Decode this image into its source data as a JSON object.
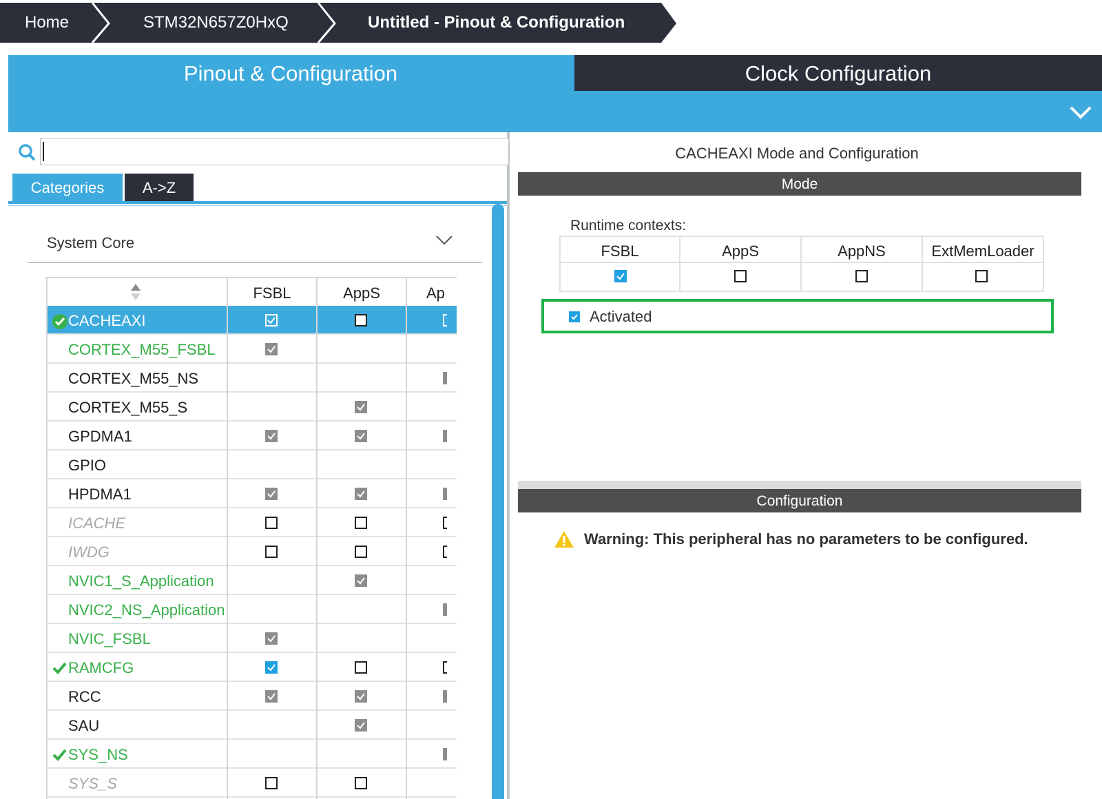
{
  "breadcrumb": {
    "items": [
      {
        "label": "Home"
      },
      {
        "label": "STM32N657Z0HxQ"
      },
      {
        "label": "Untitled - Pinout & Configuration"
      }
    ]
  },
  "main_tabs": {
    "pinout": "Pinout & Configuration",
    "clock": "Clock Configuration"
  },
  "left_panel": {
    "search": {
      "value": "",
      "placeholder": ""
    },
    "tabs": {
      "categories": "Categories",
      "atoz": "A->Z"
    },
    "category": "System Core",
    "table": {
      "columns": [
        "FSBL",
        "AppS",
        "Ap"
      ],
      "rows": [
        {
          "name": "CACHEAXI",
          "style": "normal",
          "status": "check-circle",
          "selected": true,
          "fsbl": "checked-white",
          "apps": "unchecked-white",
          "app3": "frag-white"
        },
        {
          "name": "CORTEX_M55_FSBL",
          "style": "green",
          "status": "",
          "selected": false,
          "fsbl": "checked-gray",
          "apps": "none",
          "app3": "none"
        },
        {
          "name": "CORTEX_M55_NS",
          "style": "normal",
          "status": "",
          "selected": false,
          "fsbl": "none",
          "apps": "none",
          "app3": "frag-gray"
        },
        {
          "name": "CORTEX_M55_S",
          "style": "normal",
          "status": "",
          "selected": false,
          "fsbl": "none",
          "apps": "checked-gray",
          "app3": "none"
        },
        {
          "name": "GPDMA1",
          "style": "normal",
          "status": "",
          "selected": false,
          "fsbl": "checked-gray",
          "apps": "checked-gray",
          "app3": "frag-gray"
        },
        {
          "name": "GPIO",
          "style": "normal",
          "status": "",
          "selected": false,
          "fsbl": "none",
          "apps": "none",
          "app3": "none"
        },
        {
          "name": "HPDMA1",
          "style": "normal",
          "status": "",
          "selected": false,
          "fsbl": "checked-gray",
          "apps": "checked-gray",
          "app3": "frag-gray"
        },
        {
          "name": "ICACHE",
          "style": "disabled",
          "status": "",
          "selected": false,
          "fsbl": "unchecked",
          "apps": "unchecked",
          "app3": "frag-empty"
        },
        {
          "name": "IWDG",
          "style": "disabled",
          "status": "",
          "selected": false,
          "fsbl": "unchecked",
          "apps": "unchecked",
          "app3": "frag-empty"
        },
        {
          "name": "NVIC1_S_Application",
          "style": "green",
          "status": "",
          "selected": false,
          "fsbl": "none",
          "apps": "checked-gray",
          "app3": "none"
        },
        {
          "name": "NVIC2_NS_Application",
          "style": "green",
          "status": "",
          "selected": false,
          "fsbl": "none",
          "apps": "none",
          "app3": "frag-gray"
        },
        {
          "name": "NVIC_FSBL",
          "style": "green",
          "status": "",
          "selected": false,
          "fsbl": "checked-gray",
          "apps": "none",
          "app3": "none"
        },
        {
          "name": "RAMCFG",
          "style": "green",
          "status": "check",
          "selected": false,
          "fsbl": "checked-blue",
          "apps": "unchecked",
          "app3": "frag-empty"
        },
        {
          "name": "RCC",
          "style": "normal",
          "status": "",
          "selected": false,
          "fsbl": "checked-gray",
          "apps": "checked-gray",
          "app3": "frag-gray"
        },
        {
          "name": "SAU",
          "style": "normal",
          "status": "",
          "selected": false,
          "fsbl": "none",
          "apps": "checked-gray",
          "app3": "none"
        },
        {
          "name": "SYS_NS",
          "style": "green",
          "status": "check",
          "selected": false,
          "fsbl": "none",
          "apps": "none",
          "app3": "frag-gray"
        },
        {
          "name": "SYS_S",
          "style": "disabled",
          "status": "",
          "selected": false,
          "fsbl": "unchecked",
          "apps": "unchecked",
          "app3": "none"
        }
      ]
    }
  },
  "right_panel": {
    "title": "CACHEAXI Mode and Configuration",
    "mode_label": "Mode",
    "runtime_label": "Runtime contexts:",
    "contexts": [
      {
        "name": "FSBL",
        "checked": true
      },
      {
        "name": "AppS",
        "checked": false
      },
      {
        "name": "AppNS",
        "checked": false
      },
      {
        "name": "ExtMemLoader",
        "checked": false
      }
    ],
    "activated_label": "Activated",
    "activated_checked": true,
    "config_label": "Configuration",
    "warning": "Warning: This peripheral has no parameters to be configured."
  },
  "colors": {
    "accent": "#3daadd",
    "dark": "#2a2f3a",
    "green": "#38b04a",
    "highlight_border": "#1fb34a",
    "warning": "#f5c518"
  },
  "icons": {
    "search": "search-icon",
    "collapse": "chevron-down-icon",
    "category_toggle": "chevron-down-icon",
    "sort": "sort-icon",
    "status_ok": "check-circle-icon",
    "status_configured": "check-icon",
    "warning": "warning-icon"
  }
}
